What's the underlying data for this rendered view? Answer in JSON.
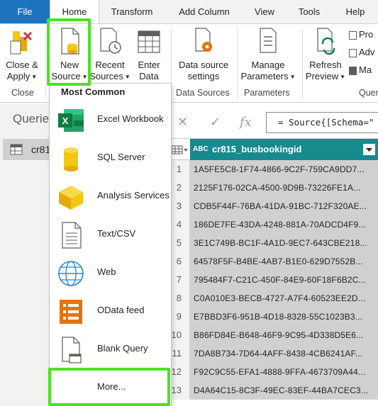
{
  "tabs": [
    {
      "label": "File"
    },
    {
      "label": "Home"
    },
    {
      "label": "Transform"
    },
    {
      "label": "Add Column"
    },
    {
      "label": "View"
    },
    {
      "label": "Tools"
    },
    {
      "label": "Help"
    }
  ],
  "ribbon": {
    "close_apply": {
      "line1": "Close &",
      "line2": "Apply"
    },
    "new_source": {
      "line1": "New",
      "line2": "Source"
    },
    "recent_sources": {
      "line1": "Recent",
      "line2": "Sources"
    },
    "enter_data": {
      "line1": "Enter",
      "line2": "Data"
    },
    "data_source_settings": {
      "line1": "Data source",
      "line2": "settings"
    },
    "manage_parameters": {
      "line1": "Manage",
      "line2": "Parameters"
    },
    "refresh_preview": {
      "line1": "Refresh",
      "line2": "Preview"
    },
    "small_buttons": [
      "Pro",
      "Adv",
      "Ma"
    ],
    "groups": {
      "close": "Close",
      "data_sources": "Data Sources",
      "parameters": "Parameters",
      "query": "Quer"
    }
  },
  "queries": {
    "title": "Querie",
    "item": "cr81"
  },
  "formula": {
    "text": "= Source{[Schema=\"",
    "fx": "fx"
  },
  "grid": {
    "column": {
      "type": "ABC",
      "name": "cr815_busbookingid"
    },
    "rows": [
      {
        "n": "1",
        "v": "1A5FE5C8-1F74-4866-9C2F-759CA9DD7..."
      },
      {
        "n": "2",
        "v": "2125F176-02CA-4500-9D9B-73226FE1A..."
      },
      {
        "n": "3",
        "v": "CDB5F44F-76BA-41DA-91BC-712F320AE..."
      },
      {
        "n": "4",
        "v": "186DE7FE-43DA-4248-881A-70ADCD4F9..."
      },
      {
        "n": "5",
        "v": "3E1C749B-BC1F-4A1D-9EC7-643CBE218..."
      },
      {
        "n": "6",
        "v": "64578F5F-B4BE-4AB7-B1E0-629D7552B..."
      },
      {
        "n": "7",
        "v": "795484F7-C21C-450F-84E9-60F18F6B2C..."
      },
      {
        "n": "8",
        "v": "C0A010E3-BECB-4727-A7F4-60523EE2D..."
      },
      {
        "n": "9",
        "v": "E7BBD3F6-951B-4D18-8328-55C1023B3..."
      },
      {
        "n": "10",
        "v": "B86FD84E-B648-46F9-9C95-4D338D5E6..."
      },
      {
        "n": "11",
        "v": "7DA8B734-7D64-4AFF-8438-4CB6241AF..."
      },
      {
        "n": "12",
        "v": "F92C9C55-EFA1-4888-9FFA-4673709A44..."
      },
      {
        "n": "13",
        "v": "D4A64C15-8C3F-49EC-83EF-44BA7CEC3..."
      }
    ]
  },
  "menu": {
    "header": "Most Common",
    "items": [
      {
        "label": "Excel Workbook",
        "icon": "excel-icon"
      },
      {
        "label": "SQL Server",
        "icon": "database-icon"
      },
      {
        "label": "Analysis Services",
        "icon": "cube-icon"
      },
      {
        "label": "Text/CSV",
        "icon": "text-file-icon"
      },
      {
        "label": "Web",
        "icon": "globe-icon"
      },
      {
        "label": "OData feed",
        "icon": "odata-icon"
      },
      {
        "label": "Blank Query",
        "icon": "blank-query-icon"
      }
    ],
    "more": "More..."
  },
  "colors": {
    "file_tab": "#1e73be",
    "highlight": "#4be321",
    "column_header": "#178a8e"
  }
}
